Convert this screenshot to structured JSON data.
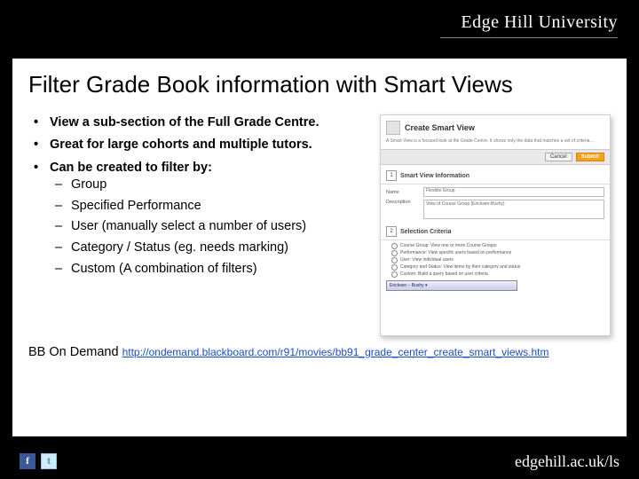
{
  "brand": "Edge Hill University",
  "title": "Filter Grade Book information with Smart Views",
  "bullets": [
    "View a sub-section of the Full Grade Centre.",
    "Great for large cohorts and multiple tutors.",
    "Can be created to filter by:"
  ],
  "sub_bullets": [
    "Group",
    "Specified Performance",
    "User (manually select a number of users)",
    "Category / Status (eg. needs marking)",
    "Custom (A combination of filters)"
  ],
  "link_prefix": "BB On Demand ",
  "link_text": "http://ondemand.blackboard.com/r91/movies/bb91_grade_center_create_smart_views.htm",
  "link_href": "http://ondemand.blackboard.com/r91/movies/bb91_grade_center_create_smart_views.htm",
  "footer_url": "edgehill.ac.uk/ls",
  "social": {
    "fb": "f",
    "tw": "t"
  },
  "mock": {
    "title": "Create Smart View",
    "cancel": "Cancel",
    "submit": "Submit",
    "sec1_num": "1",
    "sec1_label": "Smart View Information",
    "name_label": "Name",
    "name_val": "Flexible Group",
    "desc_label": "Description",
    "desc_val": "View of Course Group (Ericksen-Bushy)",
    "sec2_num": "2",
    "sec2_label": "Selection Criteria",
    "r1": "Course Group: View one or more Course Groups",
    "r2": "Performance: View specific users based on performance",
    "r3": "User: View individual users",
    "r4": "Category and Status: View items by their category and status",
    "r5": "Custom: Build a query based on user criteria"
  }
}
